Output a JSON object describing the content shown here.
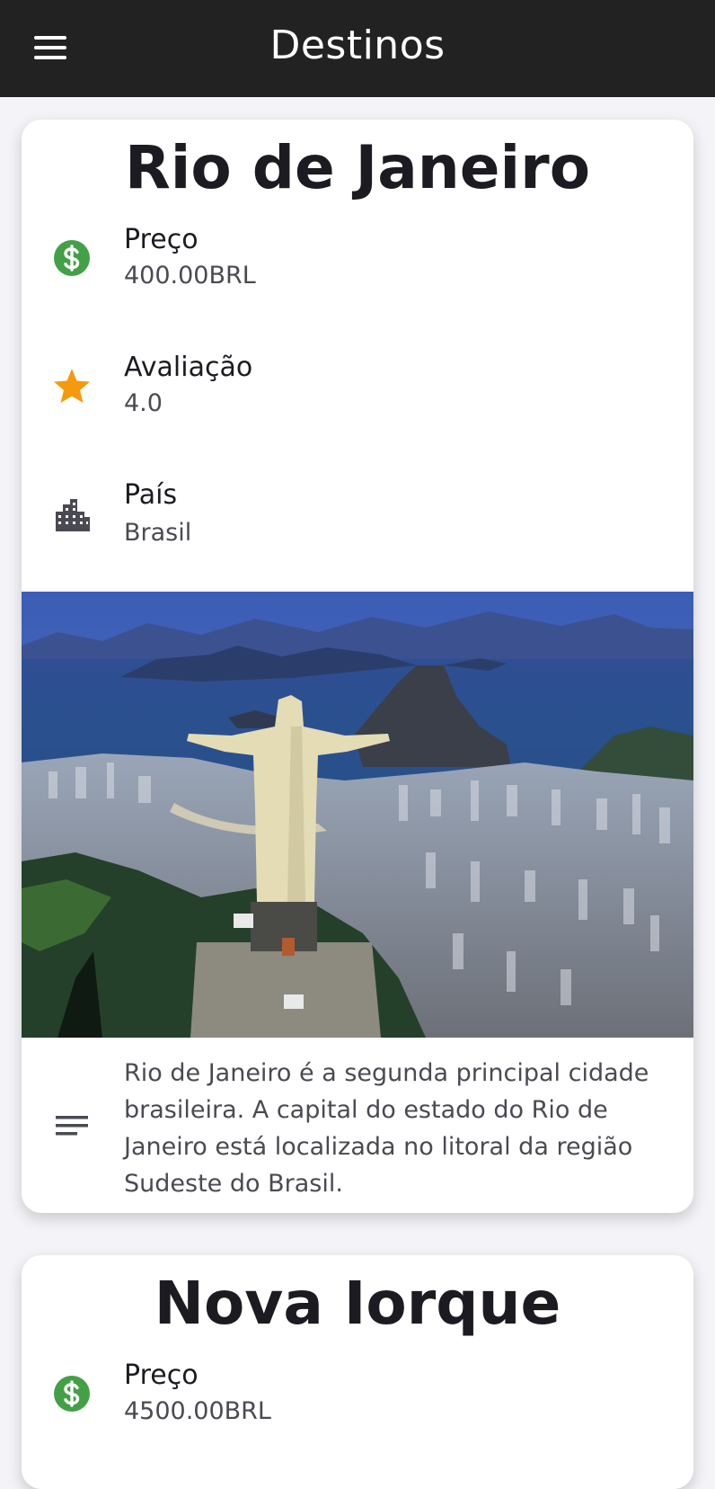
{
  "appbar": {
    "title": "Destinos",
    "menu_icon": "hamburger-menu-icon",
    "background": "#222222"
  },
  "destinations": [
    {
      "name": "Rio de Janeiro",
      "price_label": "Preço",
      "price_value": "400.00BRL",
      "price_icon": "dollar-icon",
      "rating_label": "Avaliação",
      "rating_value": "4.0",
      "rating_icon": "star-icon",
      "country_label": "País",
      "country_value": "Brasil",
      "country_icon": "city-icon",
      "image": "rio-de-janeiro-photo",
      "description_icon": "description-icon",
      "description": "Rio de Janeiro é a segunda principal cidade brasileira. A capital do estado do Rio de Janeiro está localizada no litoral da região Sudeste do Brasil."
    },
    {
      "name": "Nova Iorque",
      "price_label": "Preço",
      "price_value": "4500.00BRL",
      "price_icon": "dollar-icon"
    }
  ],
  "colors": {
    "price_green": "#43a047",
    "star_orange": "#f59a0c",
    "icon_gray": "#4a4a52"
  }
}
